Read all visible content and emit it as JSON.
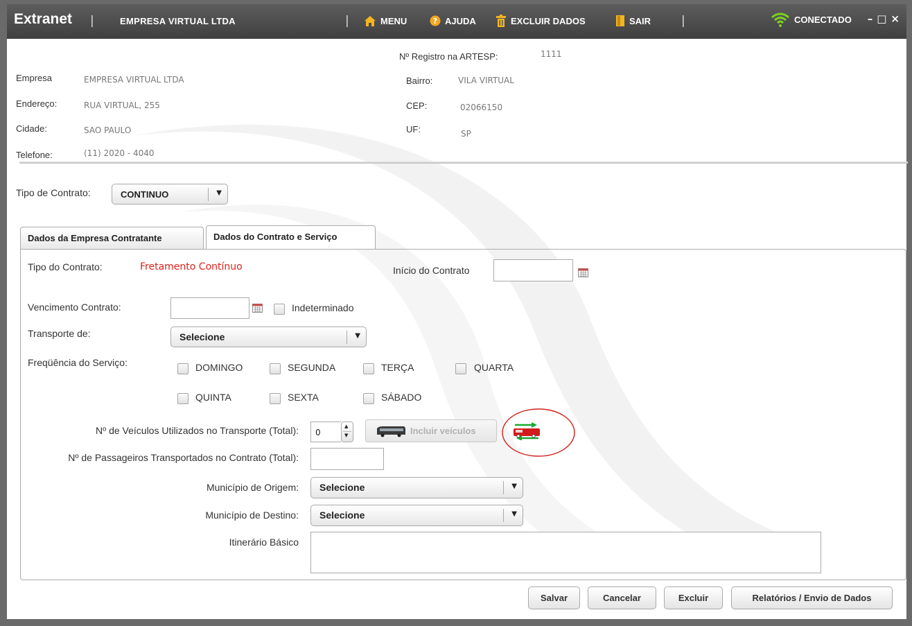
{
  "titlebar": {
    "brand": "Extranet",
    "separator": "|",
    "company": "EMPRESA VIRTUAL LTDA",
    "menu_label": "MENU",
    "help_label": "AJUDA",
    "delete_label": "EXCLUIR DADOS",
    "exit_label": "SAIR",
    "status_label": "CONECTADO",
    "win_minimize": "–",
    "win_maximize": "□",
    "win_close": "×"
  },
  "company_info": {
    "empresa_label": "Empresa",
    "empresa_value": "EMPRESA VIRTUAL LTDA",
    "endereco_label": "Endereço:",
    "endereco_value": "RUA VIRTUAL, 255",
    "cidade_label": "Cidade:",
    "cidade_value": "SAO PAULO",
    "telefone_label": "Telefone:",
    "telefone_value": "(11) 2020 - 4040",
    "registro_label": "Nº Registro na ARTESP:",
    "registro_value": "1111",
    "bairro_label": "Bairro:",
    "bairro_value": "VILA VIRTUAL",
    "cep_label": "CEP:",
    "cep_value": "02066150",
    "uf_label": "UF:",
    "uf_value": "SP"
  },
  "contract_type": {
    "label": "Tipo de Contrato:",
    "value": "CONTINUO"
  },
  "tabs": [
    {
      "label": "Dados da Empresa Contratante",
      "active": false
    },
    {
      "label": "Dados do Contrato e Serviço",
      "active": true
    }
  ],
  "form": {
    "tipo_contrato_label": "Tipo do Contrato:",
    "tipo_contrato_value": "Fretamento Contínuo",
    "tipo_contrato_color": "#e0201b",
    "inicio_label": "Início do Contrato",
    "vencimento_label": "Vencimento Contrato:",
    "indeterminado_label": "Indeterminado",
    "transporte_label": "Transporte de:",
    "transporte_value": "Selecione",
    "frequencia_label": "Freqüência do Serviço:",
    "days": [
      "DOMINGO",
      "SEGUNDA",
      "TERÇA",
      "QUARTA",
      "QUINTA",
      "SEXTA",
      "SÁBADO"
    ],
    "veiculos_label": "Nº de Veículos Utilizados no Transporte (Total):",
    "veiculos_value": "0",
    "incluir_veiculos_label": "Incluir veículos",
    "passageiros_label": "Nº de Passageiros Transportados no Contrato (Total):",
    "origem_label": "Município de Origem:",
    "origem_value": "Selecione",
    "destino_label": "Município de Destino:",
    "destino_value": "Selecione",
    "itinerario_label": "Itinerário Básico"
  },
  "actions": {
    "save": "Salvar",
    "cancel": "Cancelar",
    "delete": "Excluir",
    "reports": "Relatórios / Envio de Dados"
  },
  "icons": {
    "home": "home-icon",
    "help": "help-icon",
    "trash": "trash-icon",
    "exit": "exit-door-icon",
    "wifi": "wifi-signal-icon",
    "calendar": "calendar-icon",
    "bus": "bus-icon",
    "vehicle_transfer": "vehicle-transfer-icon"
  }
}
